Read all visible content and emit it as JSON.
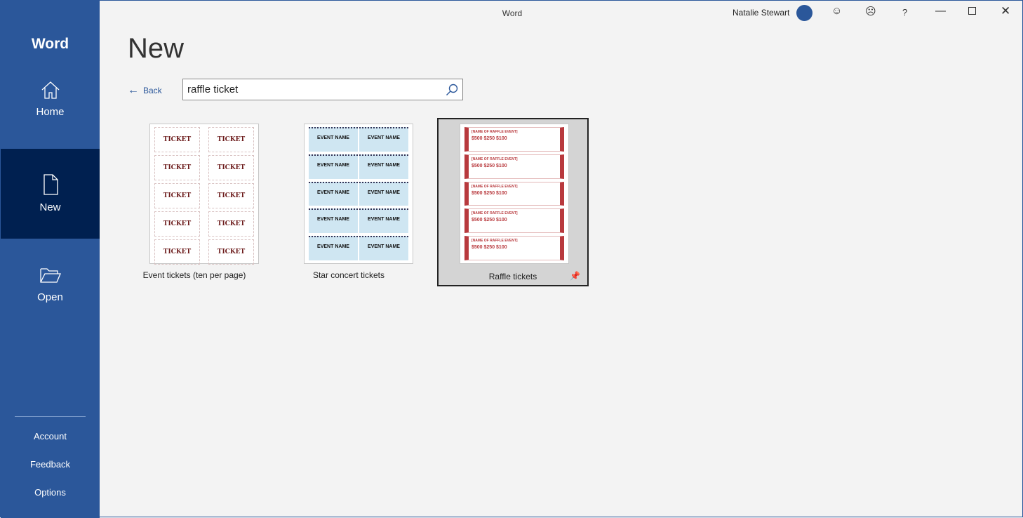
{
  "window": {
    "title": "Word",
    "user": "Natalie Stewart",
    "help": "?"
  },
  "sidebar": {
    "app": "Word",
    "items": [
      {
        "label": "Home",
        "icon": "home-icon"
      },
      {
        "label": "New",
        "icon": "new-document-icon",
        "active": true
      },
      {
        "label": "Open",
        "icon": "folder-open-icon"
      }
    ],
    "bottom": [
      "Account",
      "Feedback",
      "Options"
    ]
  },
  "main": {
    "title": "New",
    "back": "Back",
    "search": {
      "value": "raffle ticket"
    },
    "templates": [
      {
        "name": "Event tickets (ten per page)",
        "thumb_text": "TICKET"
      },
      {
        "name": "Star concert tickets",
        "thumb_text": "EVENT NAME"
      },
      {
        "name": "Raffle tickets",
        "thumb_text": "[NAME OF RAFFLE EVENT]",
        "prices": "$500 $250 $100",
        "selected": true
      }
    ]
  },
  "colors": {
    "accent": "#2b579a",
    "active_nav": "#002050",
    "raffle_red": "#b8393d"
  }
}
